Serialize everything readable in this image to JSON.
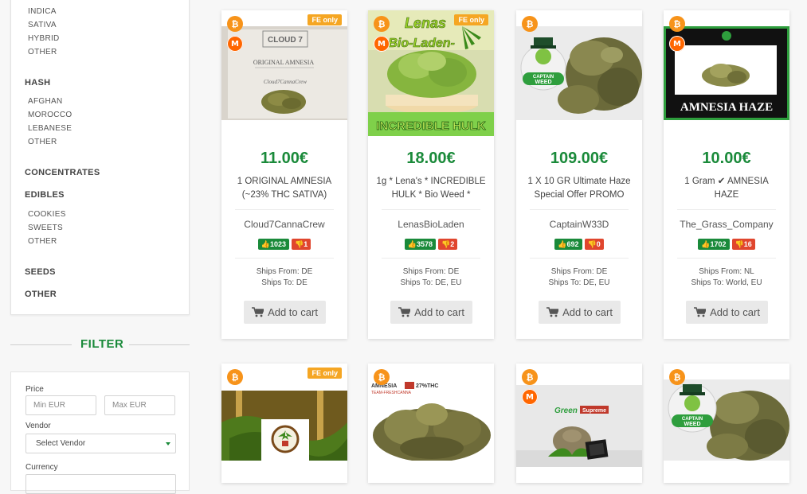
{
  "sidebar": {
    "weed_subs": [
      "INDICA",
      "SATIVA",
      "HYBRID",
      "OTHER"
    ],
    "hash_heading": "HASH",
    "hash_subs": [
      "AFGHAN",
      "MOROCCO",
      "LEBANESE",
      "OTHER"
    ],
    "concentrates": "CONCENTRATES",
    "edibles_heading": "EDIBLES",
    "edibles_subs": [
      "COOKIES",
      "SWEETS",
      "OTHER"
    ],
    "seeds": "SEEDS",
    "other": "OTHER"
  },
  "filter": {
    "title": "FILTER",
    "price_label": "Price",
    "min_placeholder": "Min EUR",
    "max_placeholder": "Max EUR",
    "vendor_label": "Vendor",
    "vendor_value": "Select Vendor",
    "currency_label": "Currency"
  },
  "products": [
    {
      "fe_tag": "FE only",
      "price": "11.00€",
      "title": "1 ORIGINAL AMNESIA (~23% THC SATIVA)",
      "vendor": "Cloud7CannaCrew",
      "pos": "1023",
      "neg": "1",
      "ships_from": "Ships From: DE",
      "ships_to": "Ships To: DE",
      "cart": "Add to cart",
      "img_text": [
        "CLOUD 7",
        "ORIGINAL AMNESIA",
        "Cloud7CannaCrew"
      ]
    },
    {
      "fe_tag": "FE only",
      "price": "18.00€",
      "title": "1g * Lena's * INCREDIBLE HULK * Bio Weed *",
      "vendor": "LenasBioLaden",
      "pos": "3578",
      "neg": "2",
      "ships_from": "Ships From: DE",
      "ships_to": "Ships To: DE, EU",
      "cart": "Add to cart",
      "img_text": [
        "Lenas",
        "-Bio-Laden-",
        "INCREDIBLE HULK"
      ]
    },
    {
      "price": "109.00€",
      "title": "1 X 10 GR Ultimate Haze Special Offer PROMO",
      "vendor": "CaptainW33D",
      "pos": "692",
      "neg": "0",
      "ships_from": "Ships From: DE",
      "ships_to": "Ships To: DE, EU",
      "cart": "Add to cart",
      "img_text": [
        "CAPTAIN",
        "WEED"
      ]
    },
    {
      "price": "10.00€",
      "title": "1 Gram ✔ AMNESIA HAZE",
      "vendor": "The_Grass_Company",
      "pos": "1702",
      "neg": "16",
      "ships_from": "Ships From: NL",
      "ships_to": "Ships To: World, EU",
      "cart": "Add to cart",
      "img_text": [
        "AMNESIA HAZE"
      ]
    }
  ],
  "products_row2": [
    {
      "fe_tag": "FE only"
    },
    {
      "img_text": [
        "AMNESIA",
        "27%THC",
        "TEAM-FRESHCANNA"
      ]
    },
    {
      "img_text": [
        "Green",
        "Supreme"
      ]
    },
    {
      "img_text": [
        "CAPTAIN",
        "WEED"
      ]
    }
  ],
  "icons": {
    "btc": "₿",
    "xmr": "M",
    "thumbs_up": "thumbs-up-icon",
    "thumbs_down": "thumbs-down-icon",
    "cart": "shopping-cart-icon"
  },
  "colors": {
    "accent_green": "#1a8a3a",
    "negative_red": "#e0462e",
    "btc_orange": "#f7931a",
    "fe_tag": "#f5a623"
  }
}
